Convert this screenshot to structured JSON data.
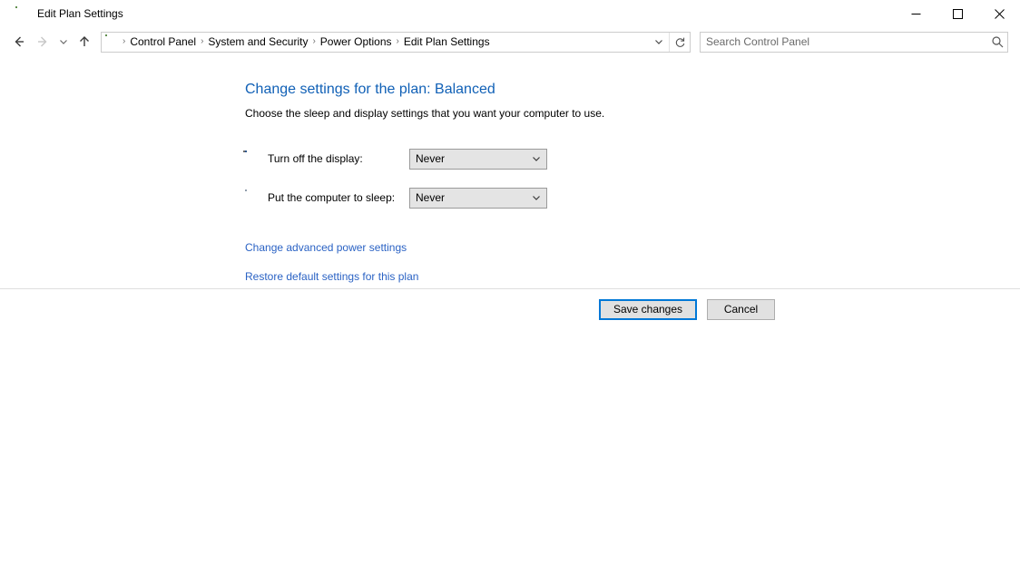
{
  "window": {
    "title": "Edit Plan Settings",
    "icon": "power-options-icon",
    "minimize_label": "Minimize",
    "maximize_label": "Maximize",
    "close_label": "Close"
  },
  "nav": {
    "back_label": "Back",
    "forward_label": "Forward",
    "recent_label": "Recent locations",
    "up_label": "Up one level",
    "breadcrumbs": [
      {
        "label": "Control Panel"
      },
      {
        "label": "System and Security"
      },
      {
        "label": "Power Options"
      },
      {
        "label": "Edit Plan Settings"
      }
    ],
    "separator": "›",
    "dropdown_label": "Previous locations",
    "refresh_label": "Refresh"
  },
  "search": {
    "placeholder": "Search Control Panel",
    "value": "",
    "icon": "search-icon"
  },
  "main": {
    "title": "Change settings for the plan: Balanced",
    "subtitle": "Choose the sleep and display settings that you want your computer to use.",
    "settings": [
      {
        "icon": "display-clock-icon",
        "label": "Turn off the display:",
        "value": "Never"
      },
      {
        "icon": "sleep-moon-icon",
        "label": "Put the computer to sleep:",
        "value": "Never"
      }
    ],
    "links": [
      {
        "label": "Change advanced power settings"
      },
      {
        "label": "Restore default settings for this plan"
      }
    ]
  },
  "footer": {
    "save_label": "Save changes",
    "cancel_label": "Cancel"
  },
  "colors": {
    "heading": "#1060b6",
    "link": "#2a62c4",
    "focus_border": "#0078d7",
    "button_face": "#e1e1e1",
    "combo_face": "#e4e4e4"
  }
}
